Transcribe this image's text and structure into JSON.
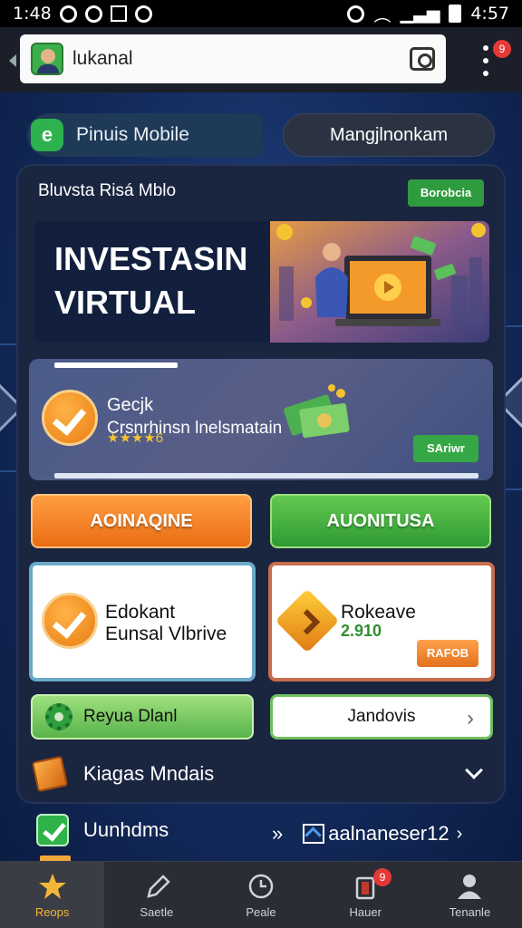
{
  "status_bar": {
    "left_time": "1:48",
    "right_time": "4:57"
  },
  "search": {
    "value": "lukanal"
  },
  "tabs": {
    "left_label": "Pinuis Mobile",
    "left_icon_letter": "e",
    "right_label": "Mangjlnonkam"
  },
  "panel": {
    "title": "Bluvsta Risá Mblo",
    "chip": "Borobcia"
  },
  "hero": {
    "line1": "INVESTASIN",
    "line2": "VIRTUAL"
  },
  "promo": {
    "line1": "Gecjk",
    "line2": "Crsnrhinsn lnelsmatain",
    "stars": "★★★★6",
    "button": "SAriwr"
  },
  "buttons": {
    "orange": "AOINAQINE",
    "green": "AUONITUSA"
  },
  "cards": {
    "left_line1": "Edokant",
    "left_line2": "Eunsal Vlbrive",
    "right_line1": "Rokeave",
    "right_number": "2.910",
    "right_button": "RAFOB"
  },
  "pills": {
    "left": "Reyua Dlanl",
    "right": "Jandovis",
    "right_chevron": "›"
  },
  "expand": {
    "label": "Kiagas Mndais",
    "icon": "cube-icon"
  },
  "under": {
    "label": "Uunhdms",
    "right_prefix": "»",
    "right_label": "aalnaneser12",
    "right_chevron": "›"
  },
  "badges": {
    "menu": "9",
    "nav": "9"
  },
  "nav": [
    {
      "label": "Reops",
      "icon": "star-icon",
      "active": true
    },
    {
      "label": "Saetle",
      "icon": "pen-icon",
      "active": false
    },
    {
      "label": "Peale",
      "icon": "clock-icon",
      "active": false
    },
    {
      "label": "Hauer",
      "icon": "trash-icon",
      "active": false
    },
    {
      "label": "Tenanle",
      "icon": "person-icon",
      "active": false
    }
  ],
  "colors": {
    "accent_orange": "#ea6d14",
    "accent_green": "#2f9a34",
    "background": "#142c5e"
  }
}
